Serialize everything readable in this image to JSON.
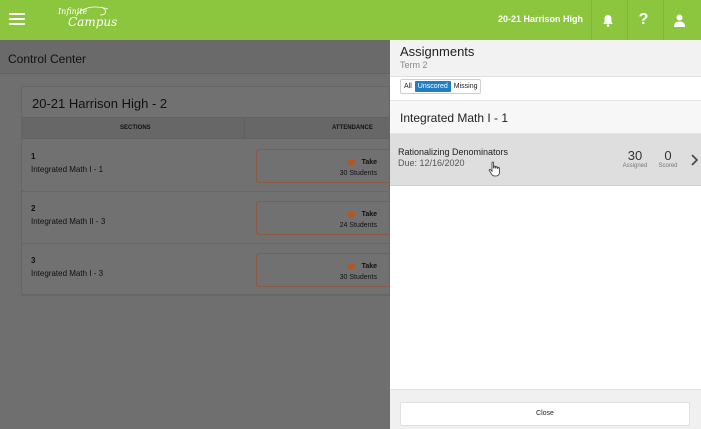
{
  "topbar": {
    "logo_line1": "Infinite",
    "logo_line2": "Campus",
    "school": "20-21 Harrison High",
    "help_label": "?"
  },
  "control_center": {
    "title": "Control Center",
    "card_title": "20-21 Harrison High - 2",
    "columns": [
      "SECTIONS",
      "ATTENDANCE"
    ],
    "rows": [
      {
        "number": "1",
        "course": "Integrated Math I - 1",
        "take_label": "Take",
        "students": "30 Students"
      },
      {
        "number": "2",
        "course": "Integrated Math II - 3",
        "take_label": "Take",
        "students": "24 Students"
      },
      {
        "number": "3",
        "course": "Integrated Math I - 3",
        "take_label": "Take",
        "students": "30 Students"
      }
    ]
  },
  "assignments_panel": {
    "title": "Assignments",
    "term": "Term 2",
    "filters": [
      {
        "label": "All",
        "active": false
      },
      {
        "label": "Unscored",
        "active": true
      },
      {
        "label": "Missing",
        "active": false
      }
    ],
    "section_title": "Integrated Math I - 1",
    "items": [
      {
        "name": "Rationalizing Denominators",
        "due": "Due: 12/16/2020",
        "assigned_value": "30",
        "assigned_label": "Assigned",
        "scored_value": "0",
        "scored_label": "Scored"
      }
    ],
    "close_label": "Close"
  },
  "colors": {
    "topbar": "#8cc63f",
    "active_filter": "#1f7fc6",
    "take_dot": "#b8571d"
  },
  "icons": [
    "menu-icon",
    "bell-icon",
    "help-icon",
    "user-icon",
    "chevron-right-icon",
    "hand-cursor-icon"
  ]
}
